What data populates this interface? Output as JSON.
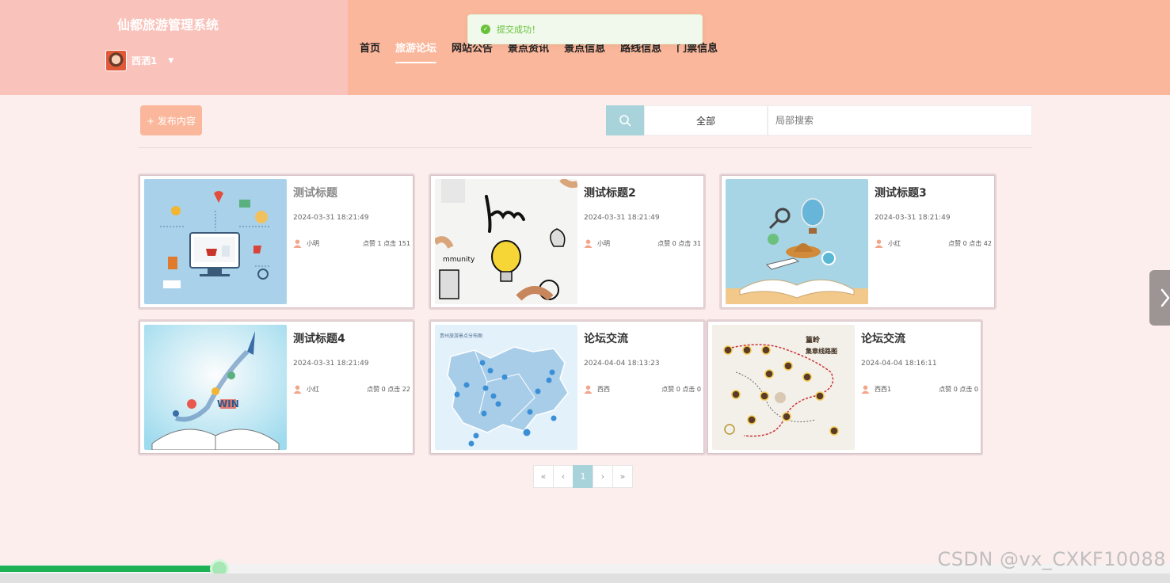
{
  "header": {
    "site_title": "仙都旅游管理系统",
    "user_name": "西洒1",
    "nav": [
      "首页",
      "旅游论坛",
      "网站公告",
      "景点资讯",
      "景点信息",
      "路线信息",
      "门票信息"
    ],
    "active_nav": "旅游论坛"
  },
  "toast": {
    "text": "提交成功！"
  },
  "toolbar": {
    "publish_label": "+ 发布内容",
    "search_scope": "全部",
    "search_placeholder": "局部搜索"
  },
  "posts": [
    {
      "title": "测试标题",
      "date": "2024-03-31 18:21:49",
      "author": "小明",
      "stats": "点赞 1 点击 151",
      "image": "shopping-illustration"
    },
    {
      "title": "测试标题2",
      "date": "2024-03-31 18:21:49",
      "author": "小明",
      "stats": "点赞 0 点击 31",
      "image": "learn-lightbulb"
    },
    {
      "title": "测试标题3",
      "date": "2024-03-31 18:21:49",
      "author": "小红",
      "stats": "点赞 0 点击 42",
      "image": "travel-book"
    },
    {
      "title": "测试标题4",
      "date": "2024-03-31 18:21:49",
      "author": "小红",
      "stats": "点赞 0 点击 22",
      "image": "rocket-book"
    },
    {
      "title": "论坛交流",
      "date": "2024-04-04 18:13:23",
      "author": "西西",
      "stats": "点赞 0 点击 0",
      "image": "province-map"
    },
    {
      "title": "论坛交流",
      "date": "2024-04-04 18:16:11",
      "author": "西西1",
      "stats": "点赞 0 点击 0",
      "image": "route-map"
    }
  ],
  "pagination": {
    "first": "«",
    "prev": "‹",
    "current": "1",
    "next": "›",
    "last": "»"
  },
  "watermark": "CSDN @vx_CXKF10088",
  "video": {
    "progress": 0.188,
    "fill_color": "#1cb255"
  },
  "colors": {
    "header": "#fbb79b",
    "brand_area": "#f9c3bb",
    "accent": "#a9d3da",
    "background": "#fdeeee"
  }
}
